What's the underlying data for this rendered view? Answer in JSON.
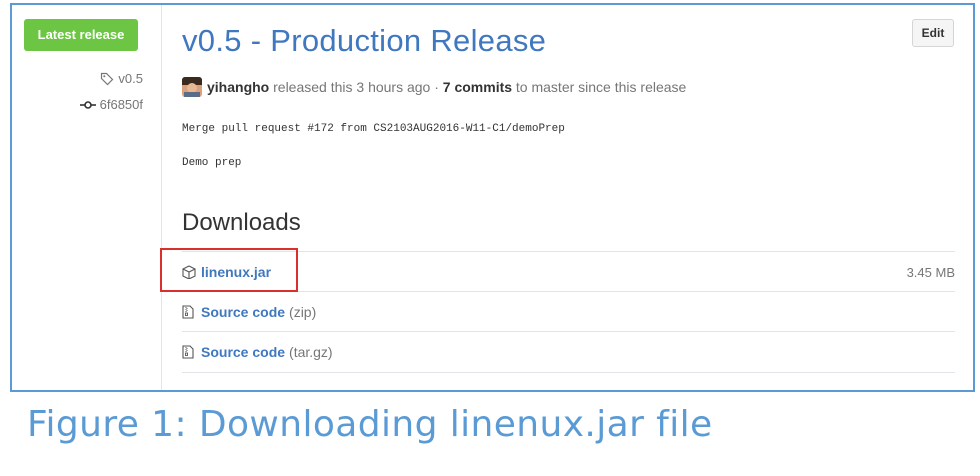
{
  "sidebar": {
    "badge_label": "Latest release",
    "tag_label": "v0.5",
    "commit_label": "6f6850f"
  },
  "release": {
    "title": "v0.5 - Production Release",
    "edit_label": "Edit",
    "author": "yihangho",
    "released_text": " released this 3 hours ago · ",
    "commits_label": "7 commits",
    "since_text": " to master since this release",
    "body_line1": "Merge pull request #172 from CS2103AUG2016-W11-C1/demoPrep",
    "body_line2": "Demo prep"
  },
  "downloads": {
    "heading": "Downloads",
    "items": [
      {
        "label": "linenux.jar",
        "ext": "",
        "size": "3.45 MB",
        "icon": "package-icon"
      },
      {
        "label": "Source code",
        "ext": "(zip)",
        "size": "",
        "icon": "file-zip-icon"
      },
      {
        "label": "Source code",
        "ext": "(tar.gz)",
        "size": "",
        "icon": "file-zip-icon"
      }
    ]
  },
  "caption": "Figure 1: Downloading linenux.jar file",
  "colors": {
    "badge_green": "#6cc644",
    "link_blue": "#4078c0",
    "frame_blue": "#5b9bd5",
    "highlight_red": "#d9302c"
  }
}
